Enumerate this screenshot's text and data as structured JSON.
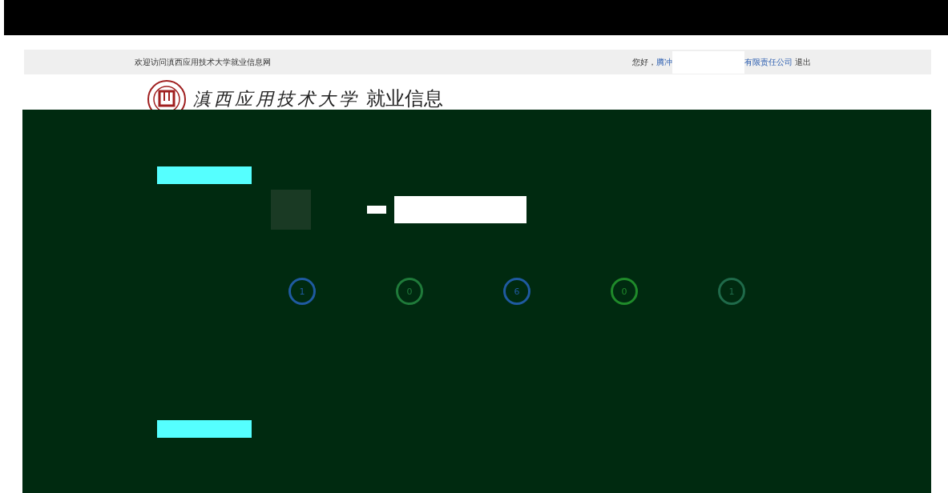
{
  "top_bar": {
    "welcome": "欢迎访问滇西应用技术大学就业信息网",
    "greeting": "您好，",
    "company_start": "腾冲",
    "company_end": "有限责任公司",
    "logout": "退出"
  },
  "header": {
    "school_name": "滇西应用技术大学",
    "site_name": "就业信息"
  },
  "stats": [
    {
      "value": "1",
      "color": "#1f5aa0"
    },
    {
      "value": "0",
      "color": "#1f7a3a"
    },
    {
      "value": "6",
      "color": "#1f5aa0"
    },
    {
      "value": "0",
      "color": "#1f8a2a"
    },
    {
      "value": "1",
      "color": "#1f6a4a"
    }
  ]
}
